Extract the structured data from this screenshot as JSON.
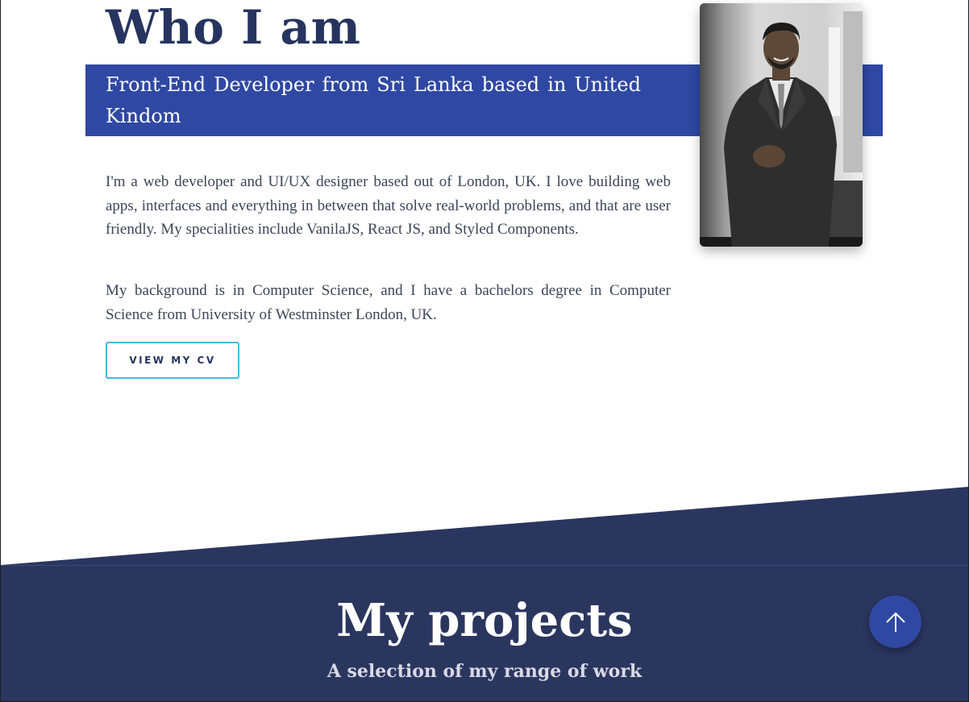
{
  "about": {
    "title": "Who I am",
    "tagline": "Front-End Developer from Sri Lanka based in United Kindom",
    "paragraphs": [
      "I'm a web developer and UI/UX designer based out of London, UK. I love building web apps, interfaces and everything in between that solve real-world problems, and that are user friendly. My specialities include VanilaJS, React JS, and Styled Components.",
      "My background is in Computer Science, and I have a bachelors degree in Computer Science from University of Westminster London, UK."
    ],
    "cv_button_label": "VIEW MY CV",
    "photo_icon": "profile-photo"
  },
  "projects": {
    "title": "My projects",
    "subtitle": "A selection of my range of work"
  },
  "scroll_top": {
    "icon": "arrow-up-icon"
  },
  "colors": {
    "navy": "#26345f",
    "accent_blue": "#2f48a3",
    "button_border": "#46b7e3",
    "projects_bg": "#2b365f",
    "body_text": "#3b4557"
  }
}
